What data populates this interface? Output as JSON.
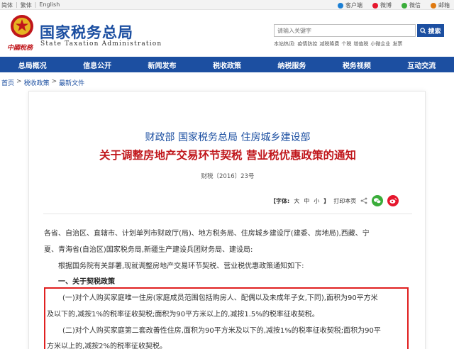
{
  "topbar": {
    "lang": [
      "简体",
      "繁体",
      "English"
    ],
    "links": [
      {
        "label": "客户端",
        "icon": "mobile-icon",
        "color": "#1c7fd4"
      },
      {
        "label": "微博",
        "icon": "weibo-icon",
        "color": "#e6162d"
      },
      {
        "label": "微信",
        "icon": "wechat-icon",
        "color": "#3aad3a"
      },
      {
        "label": "邮箱",
        "icon": "mail-icon",
        "color": "#e07a10"
      }
    ]
  },
  "header": {
    "brand_cn": "国家税务总局",
    "brand_en": "State Taxation Administration",
    "sublogo": "中國稅務",
    "search_placeholder": "请输入关键字",
    "search_button": "搜索",
    "hotwords_label": "本站热词:",
    "hotwords": [
      "疫情防控",
      "减税降费",
      "个税",
      "增值税",
      "小微企业",
      "发票"
    ]
  },
  "nav": [
    "总局概况",
    "信息公开",
    "新闻发布",
    "税收政策",
    "纳税服务",
    "税务视频",
    "互动交流"
  ],
  "breadcrumb": [
    "首页",
    "税收政策",
    "最新文件"
  ],
  "article": {
    "issuer": "财政部 国家税务总局 住房城乡建设部",
    "title": "关于调整房地产交易环节契税 营业税优惠政策的通知",
    "doc_no": "财税〔2016〕23号",
    "font_size_label": "【字体:",
    "font_sizes": [
      "大",
      "中",
      "小"
    ],
    "font_size_end": "】",
    "print_label": "打印本页",
    "paragraphs": {
      "p1": "各省、自治区、直辖市、计划单列市财政厅(局)、地方税务局、住房城乡建设厅(建委、房地局),西藏、宁",
      "p2": "夏、青海省(自治区)国家税务局,新疆生产建设兵团财务局、建设局:",
      "p3": "根据国务院有关部署,现就调整房地产交易环节契税、营业税优惠政策通知如下:",
      "h1": "一、关于契税政策",
      "p4": "(一)对个人购买家庭唯一住房(家庭成员范围包括购房人、配偶以及未成年子女,下同),面积为90平方米",
      "p5": "及以下的,减按1%的税率征收契税;面积为90平方米以上的,减按1.5%的税率征收契税。",
      "p6": "(二)对个人购买家庭第二套改善性住房,面积为90平方米及以下的,减按1%的税率征收契税;面积为90平",
      "p7": "方米以上的,减按2%的税率征收契税。"
    }
  },
  "colors": {
    "brand_blue": "#1c4fa1",
    "title_red": "#c0161b",
    "highlight_red": "#e02020"
  }
}
